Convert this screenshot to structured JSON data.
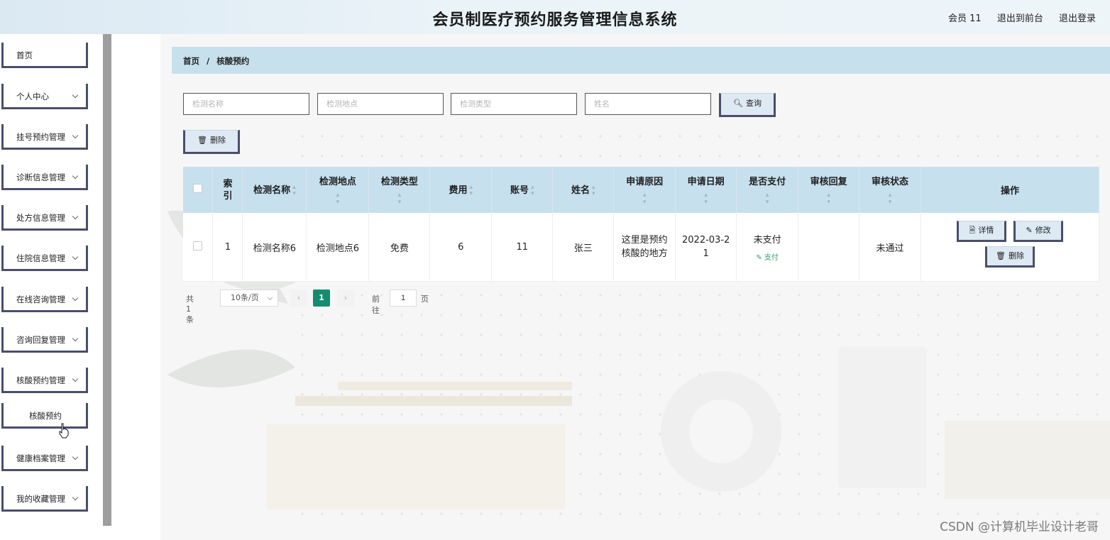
{
  "header": {
    "title": "会员制医疗预约服务管理信息系统",
    "user": "会员 11",
    "frontend_link": "退出到前台",
    "logout_link": "退出登录"
  },
  "sidebar": {
    "items": [
      {
        "label": "首页",
        "has_arrow": false
      },
      {
        "label": "个人中心",
        "has_arrow": true
      },
      {
        "label": "挂号预约管理",
        "has_arrow": true
      },
      {
        "label": "诊断信息管理",
        "has_arrow": true
      },
      {
        "label": "处方信息管理",
        "has_arrow": true
      },
      {
        "label": "住院信息管理",
        "has_arrow": true
      },
      {
        "label": "在线咨询管理",
        "has_arrow": true
      },
      {
        "label": "咨询回复管理",
        "has_arrow": true
      },
      {
        "label": "核酸预约管理",
        "has_arrow": true
      },
      {
        "label": "核酸预约",
        "sub": true
      },
      {
        "label": "健康档案管理",
        "has_arrow": true
      },
      {
        "label": "我的收藏管理",
        "has_arrow": true
      }
    ]
  },
  "breadcrumb": {
    "home": "首页",
    "separator": "/",
    "current": "核酸预约"
  },
  "search": {
    "name_placeholder": "检测名称",
    "location_placeholder": "检测地点",
    "type_placeholder": "检测类型",
    "person_placeholder": "姓名",
    "query_label": "查询"
  },
  "toolbar": {
    "delete_label": "删除"
  },
  "table": {
    "headers": {
      "index": "索引",
      "name": "检测名称",
      "location": "检测地点",
      "type": "检测类型",
      "fee": "费用",
      "account": "账号",
      "person": "姓名",
      "reason": "申请原因",
      "date": "申请日期",
      "paid": "是否支付",
      "reply": "审核回复",
      "status": "审核状态",
      "ops": "操作"
    },
    "rows": [
      {
        "index": "1",
        "name": "检测名称6",
        "location": "检测地点6",
        "type": "免费",
        "fee": "6",
        "account": "11",
        "person": "张三",
        "reason": "这里是预约核酸的地方",
        "date": "2022-03-21",
        "paid": "未支付",
        "pay_action": "支付",
        "reply": "",
        "status": "未通过",
        "detail_label": "详情",
        "edit_label": "修改",
        "delete_label": "删除"
      }
    ]
  },
  "pagination": {
    "total": "共 1 条",
    "page_size": "10条/页",
    "current_page": "1",
    "goto_label": "前往",
    "goto_value": "1",
    "page_suffix": "页"
  },
  "watermark": "CSDN @计算机毕业设计老哥",
  "colors": {
    "accent_dark": "#4a4e6b",
    "header_bg": "#c7e0ee",
    "pager_active": "#138c6f",
    "pay_link": "#2f9a6b"
  }
}
